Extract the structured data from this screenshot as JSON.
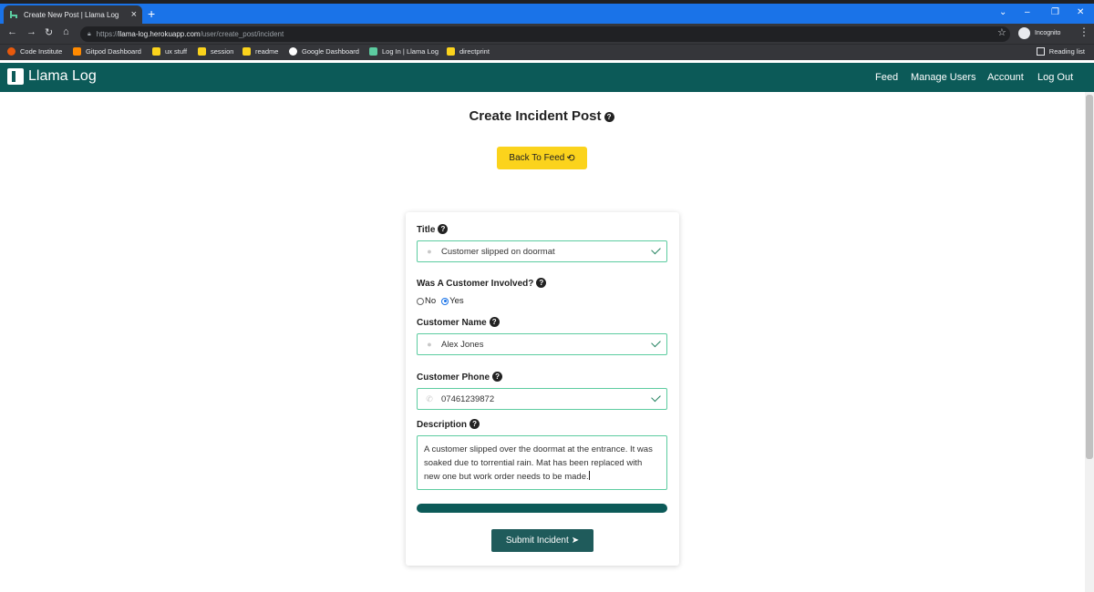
{
  "browser": {
    "tab_title": "Create New Post | Llama Log",
    "url_scheme": "https://",
    "url_host": "llama-log.herokuapp.com",
    "url_path": "/user/create_post/incident",
    "profile_label": "Incognito",
    "bookmarks": [
      "Code Institute",
      "Gitpod Dashboard",
      "ux stuff",
      "session",
      "readme",
      "Google Dashboard",
      "Log In | Llama Log",
      "directprint"
    ],
    "reading_list": "Reading list"
  },
  "nav": {
    "brand": "Llama Log",
    "links": [
      "Feed",
      "Manage Users",
      "Account",
      "Log Out"
    ]
  },
  "page": {
    "title": "Create Incident Post",
    "back_button": "Back To Feed"
  },
  "form": {
    "title_label": "Title",
    "title_value": "Customer slipped on doormat",
    "customer_involved_label": "Was A Customer Involved?",
    "option_no": "No",
    "option_yes": "Yes",
    "selected_option": "Yes",
    "customer_name_label": "Customer Name",
    "customer_name_value": "Alex Jones",
    "customer_phone_label": "Customer Phone",
    "customer_phone_value": "07461239872",
    "description_label": "Description",
    "description_value": "A customer slipped over the doormat at the entrance. It was soaked due to torrential rain. Mat has been replaced with new one but work order needs to be made.",
    "progress": 1.0,
    "submit_button": "Submit Incident"
  },
  "colors": {
    "brand": "#0c5a58",
    "back_button": "#fbd31c",
    "submit_button": "#1f5b5b",
    "valid_border": "#5ccca0"
  }
}
